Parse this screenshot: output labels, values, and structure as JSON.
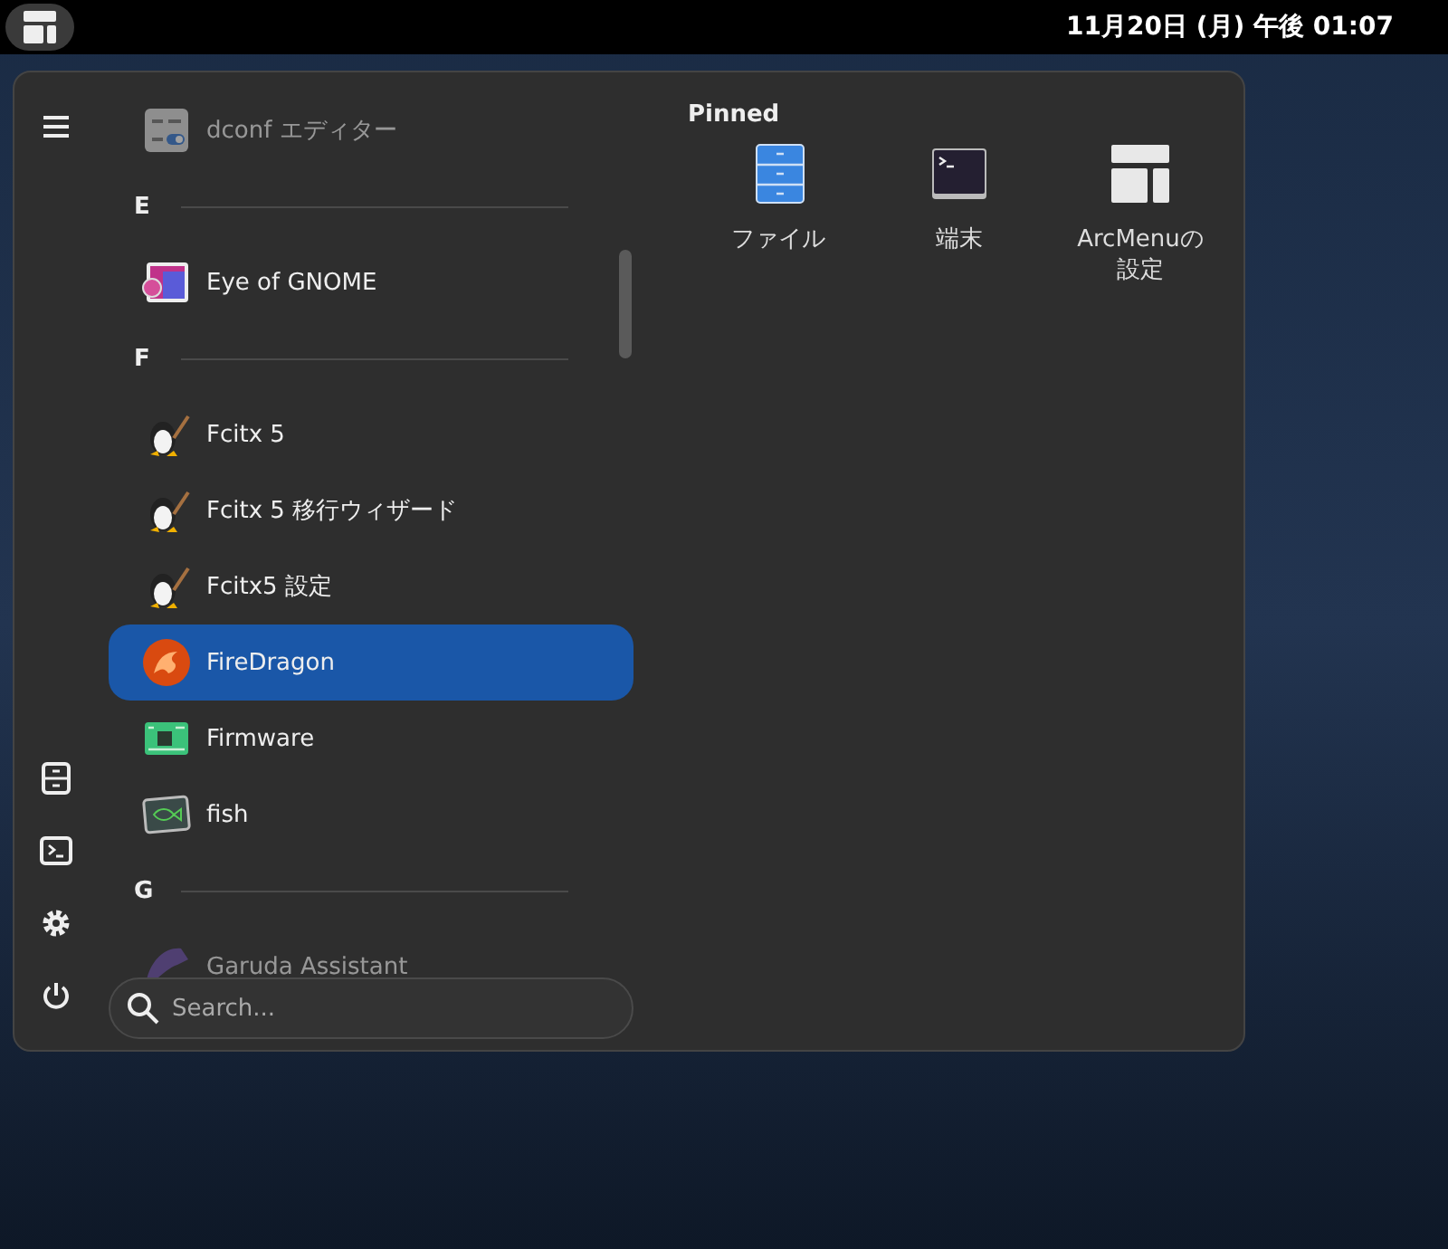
{
  "top_bar": {
    "clock": "11月20日 (月) 午後 01:07"
  },
  "sidebar": [
    {
      "kind": "menu"
    },
    {
      "kind": "files"
    },
    {
      "kind": "terminal"
    },
    {
      "kind": "settings"
    },
    {
      "kind": "power"
    }
  ],
  "apps": [
    {
      "kind": "dconf",
      "label": "dconf エディター",
      "selected": false,
      "faded": true
    },
    {
      "kind": "header",
      "label": "E"
    },
    {
      "kind": "image",
      "label": "Eye of GNOME",
      "selected": false,
      "faded": false
    },
    {
      "kind": "header",
      "label": "F"
    },
    {
      "kind": "penguin",
      "label": "Fcitx 5",
      "selected": false,
      "faded": false
    },
    {
      "kind": "penguin",
      "label": "Fcitx 5 移行ウィザード",
      "selected": false,
      "faded": false
    },
    {
      "kind": "penguin",
      "label": "Fcitx5 設定",
      "selected": false,
      "faded": false
    },
    {
      "kind": "dragon",
      "label": "FireDragon",
      "selected": true,
      "faded": false
    },
    {
      "kind": "board",
      "label": "Firmware",
      "selected": false,
      "faded": false
    },
    {
      "kind": "fish",
      "label": "fish",
      "selected": false,
      "faded": false
    },
    {
      "kind": "header",
      "label": "G"
    },
    {
      "kind": "bird",
      "label": "Garuda Assistant",
      "selected": false,
      "faded": true
    }
  ],
  "search": {
    "placeholder": "Search..."
  },
  "pinned": {
    "title": "Pinned",
    "items": [
      {
        "kind": "files",
        "label": "ファイル"
      },
      {
        "kind": "terminal",
        "label": "端末"
      },
      {
        "kind": "arcmenu",
        "label": "ArcMenuの設定"
      }
    ]
  }
}
